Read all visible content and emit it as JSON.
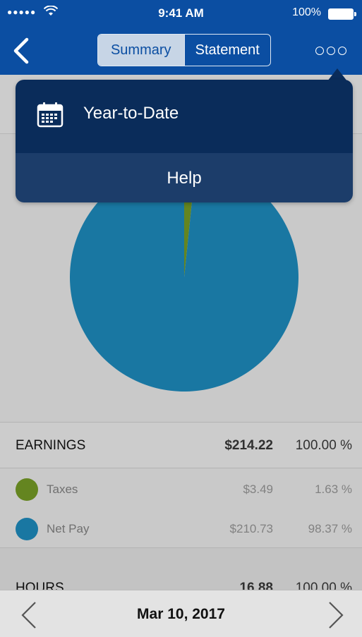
{
  "status_bar": {
    "signal": "●●●●●",
    "time": "9:41 AM",
    "battery_pct": "100%"
  },
  "nav": {
    "back_icon": "chevron-left-icon",
    "tabs": [
      {
        "label": "Summary",
        "active": true
      },
      {
        "label": "Statement",
        "active": false
      }
    ],
    "more_icon": "more-dots-icon"
  },
  "menu": {
    "items": [
      {
        "label": "Year-to-Date",
        "icon": "calendar-icon"
      },
      {
        "label": "Help"
      }
    ]
  },
  "chart_data": {
    "type": "pie",
    "slices": [
      {
        "name": "Taxes",
        "value": 3.49,
        "percent": 1.63,
        "color": "#6b8e23"
      },
      {
        "name": "Net Pay",
        "value": 210.73,
        "percent": 98.37,
        "color": "#1b7fad"
      }
    ]
  },
  "earnings": {
    "label": "EARNINGS",
    "amount": "$214.22",
    "percent": "100.00 %",
    "rows": [
      {
        "label": "Taxes",
        "amount": "$3.49",
        "percent": "1.63 %",
        "color": "#6b8e23"
      },
      {
        "label": "Net Pay",
        "amount": "$210.73",
        "percent": "98.37 %",
        "color": "#1b7fad"
      }
    ]
  },
  "hours": {
    "label": "HOURS",
    "amount": "16.88",
    "percent": "100.00 %"
  },
  "footer": {
    "date": "Mar 10, 2017",
    "prev_icon": "chevron-left-icon",
    "next_icon": "chevron-right-icon"
  }
}
